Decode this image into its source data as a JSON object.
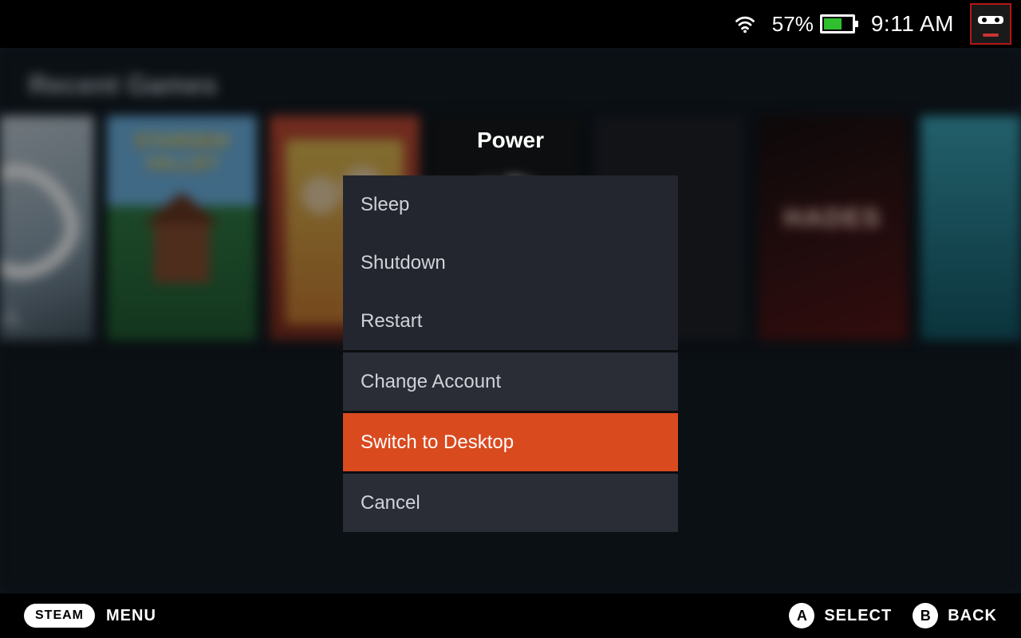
{
  "status": {
    "battery_pct": "57%",
    "battery_level": 57,
    "time": "9:11 AM"
  },
  "home": {
    "section_title": "Recent Games",
    "tiles": {
      "portal": "RTAL",
      "stardew": "STARDEW VALLEY",
      "hades": "HADES"
    }
  },
  "modal": {
    "title": "Power",
    "items": {
      "sleep": "Sleep",
      "shutdown": "Shutdown",
      "restart": "Restart",
      "change_account": "Change Account",
      "switch_desktop": "Switch to Desktop",
      "cancel": "Cancel"
    },
    "selected": "switch_desktop"
  },
  "bottom": {
    "steam": "STEAM",
    "menu": "MENU",
    "a_glyph": "A",
    "a_label": "SELECT",
    "b_glyph": "B",
    "b_label": "BACK"
  }
}
